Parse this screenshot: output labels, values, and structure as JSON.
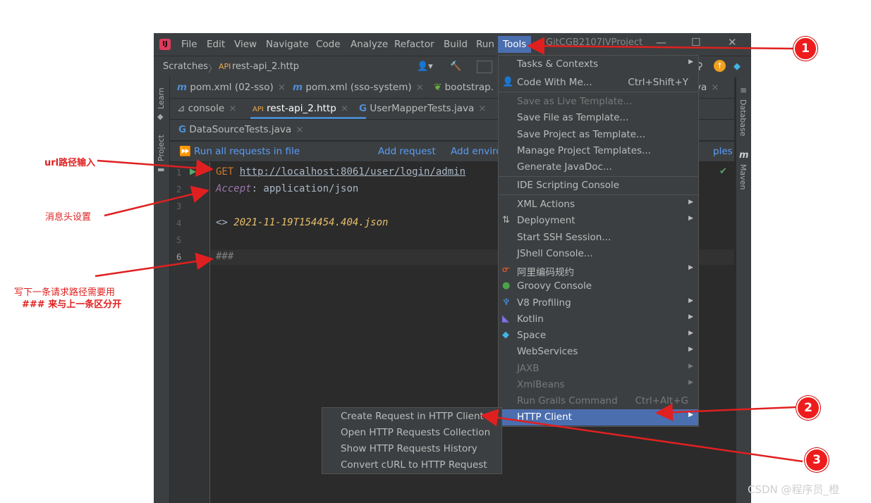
{
  "menubar": {
    "items": [
      "File",
      "Edit",
      "View",
      "Navigate",
      "Code",
      "Analyze",
      "Refactor",
      "Build",
      "Run",
      "Tools"
    ],
    "window_title": "GitCGB2107IVProject"
  },
  "navbar": {
    "scratches": "Scratches",
    "file": "rest-api_2.http"
  },
  "tabs_row1": [
    "pom.xml (02-sso)",
    "pom.xml (sso-system)",
    "bootstrap."
  ],
  "tabs_row1_right": "va",
  "tabs_row2": [
    "console",
    "rest-api_2.http",
    "UserMapperTests.java"
  ],
  "tabs_row3": [
    "DataSourceTests.java"
  ],
  "toolbar": {
    "run_all": "Run all requests in file",
    "add_request": "Add request",
    "add_env": "Add enviro",
    "samples": "ples"
  },
  "side_tools": {
    "learn": "Learn",
    "project": "Project",
    "database": "Database",
    "maven": "Maven"
  },
  "editor": {
    "line_numbers": [
      "1",
      "2",
      "3",
      "4",
      "5",
      "6"
    ],
    "line1_method": "GET",
    "line1_url": "http://localhost:8061/user/login/admin",
    "line2_key": "Accept",
    "line2_value": ": application/json",
    "line4_prefix": "<>",
    "line4_file": "2021-11-19T154454.404.json",
    "line6": "###"
  },
  "tools_menu": [
    {
      "label": "Tasks & Contexts",
      "submenu": true
    },
    {
      "label": "Code With Me...",
      "shortcut": "Ctrl+Shift+Y"
    },
    {
      "label": "Save as Live Template...",
      "disabled": true
    },
    {
      "label": "Save File as Template..."
    },
    {
      "label": "Save Project as Template..."
    },
    {
      "label": "Manage Project Templates..."
    },
    {
      "label": "Generate JavaDoc..."
    },
    {
      "label": "IDE Scripting Console"
    },
    {
      "label": "XML Actions",
      "submenu": true
    },
    {
      "label": "Deployment",
      "submenu": true
    },
    {
      "label": "Start SSH Session..."
    },
    {
      "label": "JShell Console..."
    },
    {
      "label": "阿里编码规约",
      "submenu": true
    },
    {
      "label": "Groovy Console"
    },
    {
      "label": "V8 Profiling",
      "submenu": true
    },
    {
      "label": "Kotlin",
      "submenu": true
    },
    {
      "label": "Space",
      "submenu": true
    },
    {
      "label": "WebServices",
      "submenu": true
    },
    {
      "label": "JAXB",
      "submenu": true,
      "disabled": true
    },
    {
      "label": "XmlBeans",
      "submenu": true,
      "disabled": true
    },
    {
      "label": "Run Grails Command",
      "shortcut": "Ctrl+Alt+G",
      "disabled": true
    },
    {
      "label": "HTTP Client",
      "submenu": true,
      "highlighted": true
    }
  ],
  "http_submenu": [
    "Create Request in HTTP Client",
    "Open HTTP Requests Collection",
    "Show HTTP Requests History",
    "Convert cURL to HTTP Request"
  ],
  "annotations": {
    "url": "url路径输入",
    "header": "消息头设置",
    "next_line1": "写下一条请求路径需要用",
    "next_line2": "### 来与上一条区分开"
  },
  "badges": [
    "1",
    "2",
    "3"
  ],
  "watermark": "CSDN @程序员_橙",
  "colors": {
    "accent": "#4b6eaf",
    "annotation": "#e02020",
    "ide_bg": "#2b2b2b",
    "panel": "#3c3f41"
  }
}
